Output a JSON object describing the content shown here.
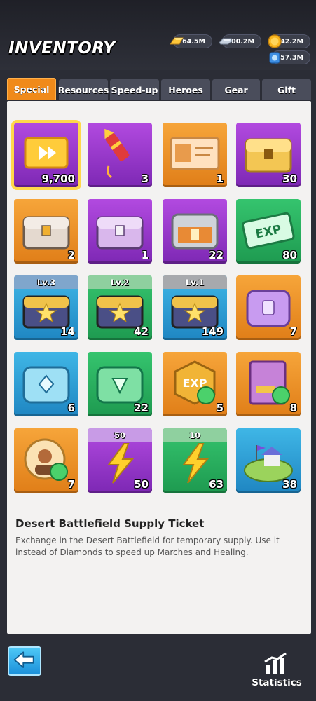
{
  "header": {
    "title": "INVENTORY",
    "resources": [
      {
        "name": "gold-bar",
        "value": "64.5M"
      },
      {
        "name": "iron",
        "value": "800.2M"
      },
      {
        "name": "coin",
        "value": "42.2M"
      },
      {
        "name": "crystal",
        "value": "57.3M"
      }
    ]
  },
  "tabs": [
    {
      "label": "Special",
      "active": true
    },
    {
      "label": "Resources"
    },
    {
      "label": "Speed-up"
    },
    {
      "label": "Heroes"
    },
    {
      "label": "Gear"
    },
    {
      "label": "Gift"
    }
  ],
  "items": [
    {
      "icon": "supply-ticket-icon",
      "count": "9,700",
      "bg": "purple",
      "selected": true
    },
    {
      "icon": "firework-rocket-icon",
      "count": "3",
      "bg": "purple"
    },
    {
      "icon": "rename-card-icon",
      "count": "1",
      "bg": "orange"
    },
    {
      "icon": "golden-chest-icon",
      "count": "30",
      "bg": "purple"
    },
    {
      "icon": "orange-chest-icon",
      "count": "2",
      "bg": "orange"
    },
    {
      "icon": "purple-chest-icon",
      "count": "1",
      "bg": "purple"
    },
    {
      "icon": "silver-gold-chest-icon",
      "count": "22",
      "bg": "purple"
    },
    {
      "icon": "exp-card-icon",
      "count": "80",
      "bg": "green"
    },
    {
      "icon": "lv3-chest-icon",
      "count": "14",
      "bg": "blue",
      "band": "Lv.3",
      "bandColor": "blue"
    },
    {
      "icon": "lv2-chest-icon",
      "count": "42",
      "bg": "green",
      "band": "Lv.2",
      "bandColor": "green"
    },
    {
      "icon": "lv1-chest-icon",
      "count": "149",
      "bg": "blue",
      "band": "Lv.1",
      "bandColor": "grey"
    },
    {
      "icon": "lilac-chest-icon",
      "count": "7",
      "bg": "orange"
    },
    {
      "icon": "blue-crystal-chest-icon",
      "count": "6",
      "bg": "blue"
    },
    {
      "icon": "green-crystal-chest-icon",
      "count": "22",
      "bg": "green"
    },
    {
      "icon": "exp-exchange-icon",
      "count": "5",
      "bg": "orange"
    },
    {
      "icon": "skill-book-exchange-icon",
      "count": "8",
      "bg": "orange"
    },
    {
      "icon": "hero-exchange-icon",
      "count": "7",
      "bg": "orange"
    },
    {
      "icon": "stamina-50-icon",
      "count": "50",
      "bg": "purple",
      "band": "50",
      "bandColor": "purple"
    },
    {
      "icon": "stamina-10-icon",
      "count": "63",
      "bg": "green",
      "band": "10",
      "bandColor": "green"
    },
    {
      "icon": "island-base-icon",
      "count": "38",
      "bg": "blue"
    }
  ],
  "detail": {
    "title": "Desert Battlefield Supply Ticket",
    "text": "Exchange in the Desert Battlefield for temporary supply. Use it instead of Diamonds to speed up Marches and Healing."
  },
  "footer": {
    "statistics_label": "Statistics"
  }
}
